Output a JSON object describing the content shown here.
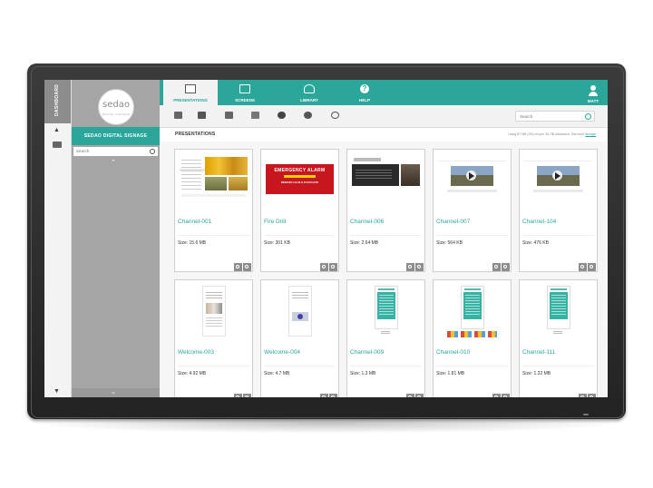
{
  "sidebar": {
    "rail_label": "DASHBOARD",
    "logo": "sedao",
    "logo_sub": "DIGITAL SIGNAGE",
    "title": "SEDAO DIGITAL SIGNAGE",
    "search_placeholder": "Search"
  },
  "nav": {
    "tabs": [
      {
        "label": "PRESENTATIONS",
        "icon": "presentation-icon",
        "active": true
      },
      {
        "label": "SCREENS",
        "icon": "monitor-icon",
        "active": false
      },
      {
        "label": "LIBRARY",
        "icon": "library-icon",
        "active": false
      },
      {
        "label": "HELP",
        "icon": "help-icon",
        "active": false
      }
    ],
    "user": "MATT",
    "help_glyph": "?"
  },
  "toolbar": {
    "search_placeholder": "Search"
  },
  "section": {
    "title": "PRESENTATIONS",
    "usage_prefix": "Using 87 MB (3%) of your 30 GB allowance. Get more ",
    "usage_link": "storage"
  },
  "cards": [
    {
      "name": "Channel-001",
      "size": "Size: 15.6 MB",
      "thumb": "site"
    },
    {
      "name": "Fire Drill",
      "size": "Size: 301 KB",
      "thumb": "alarm"
    },
    {
      "name": "Channel-006",
      "size": "Size: 2.64 MB",
      "thumb": "dark"
    },
    {
      "name": "Channel-007",
      "size": "Size: 564 KB",
      "thumb": "video"
    },
    {
      "name": "Channel-104",
      "size": "Size: 476 KB",
      "thumb": "video"
    },
    {
      "name": "Welcome-003",
      "size": "Size: 4.92 MB",
      "thumb": "doc"
    },
    {
      "name": "Welcome-004",
      "size": "Size: 4.7 MB",
      "thumb": "docvid"
    },
    {
      "name": "Channel-009",
      "size": "Size: 1.3 MB",
      "thumb": "teal"
    },
    {
      "name": "Channel-010",
      "size": "Size: 1.81 MB",
      "thumb": "tealkids"
    },
    {
      "name": "Channel-111",
      "size": "Size: 1.32 MB",
      "thumb": "teal"
    }
  ],
  "alarm_thumb": {
    "header": "EMERGENCY ALARM",
    "sub": "REMAIN CALM & EVACUATE"
  },
  "colors": {
    "accent": "#2aa69a",
    "sidebar": "#a5a5a5",
    "bezel": "#2e2e2e"
  }
}
